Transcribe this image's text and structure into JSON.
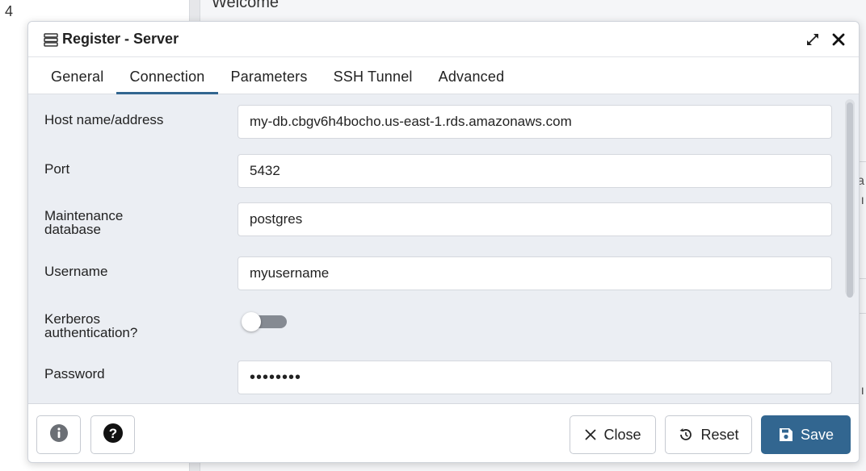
{
  "background": {
    "number": "4",
    "welcome": "Welcome",
    "frag_a": "a",
    "frag_b": "ı",
    "frag_c": "ı"
  },
  "dialog": {
    "title": "Register - Server",
    "title_icon": "server-icon",
    "maximize_icon": "expand-icon",
    "close_icon": "close-icon"
  },
  "tabs": [
    {
      "label": "General",
      "active": false
    },
    {
      "label": "Connection",
      "active": true
    },
    {
      "label": "Parameters",
      "active": false
    },
    {
      "label": "SSH Tunnel",
      "active": false
    },
    {
      "label": "Advanced",
      "active": false
    }
  ],
  "form": {
    "host": {
      "label": "Host name/address",
      "value": "my-db.cbgv6h4bocho.us-east-1.rds.amazonaws.com"
    },
    "port": {
      "label": "Port",
      "value": "5432"
    },
    "maintenance_db": {
      "label_line1": "Maintenance",
      "label_line2": "database",
      "value": "postgres"
    },
    "username": {
      "label": "Username",
      "value": "myusername"
    },
    "kerberos": {
      "label_line1": "Kerberos",
      "label_line2": "authentication?",
      "enabled": false
    },
    "password": {
      "label": "Password",
      "value": "••••••••"
    }
  },
  "footer": {
    "info_icon": "info-icon",
    "help_icon": "help-icon",
    "close_label": "Close",
    "reset_label": "Reset",
    "save_label": "Save"
  },
  "colors": {
    "accent": "#326690",
    "dialog_bg": "#ebeef3"
  }
}
